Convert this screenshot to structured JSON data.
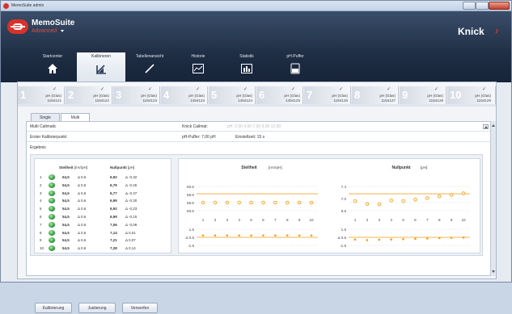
{
  "window": {
    "title": "MemoSuite admin"
  },
  "header": {
    "app_name": "MemoSuite",
    "edition": "Advanced",
    "brand": "Knick"
  },
  "tabs": [
    {
      "label": "Startcenter",
      "icon": "home-icon"
    },
    {
      "label": "Kalibrieren",
      "icon": "calibrate-icon"
    },
    {
      "label": "Tabellenansicht",
      "icon": "pen-icon"
    },
    {
      "label": "Historie",
      "icon": "history-chart-icon"
    },
    {
      "label": "Statistik",
      "icon": "statistics-icon"
    },
    {
      "label": "pH-Puffer",
      "icon": "buffer-beaker-icon"
    }
  ],
  "steps": [
    {
      "num": "1",
      "type": "pH (Glas)",
      "sn": "1154121"
    },
    {
      "num": "2",
      "type": "pH (Glas)",
      "sn": "1154122"
    },
    {
      "num": "3",
      "type": "pH (Glas)",
      "sn": "1154123"
    },
    {
      "num": "4",
      "type": "pH (Glas)",
      "sn": "1454123"
    },
    {
      "num": "5",
      "type": "pH (Glas)",
      "sn": "1454124"
    },
    {
      "num": "6",
      "type": "pH (Glas)",
      "sn": "1454125"
    },
    {
      "num": "7",
      "type": "pH (Glas)",
      "sn": "1154126"
    },
    {
      "num": "8",
      "type": "pH (Glas)",
      "sn": "1154127"
    },
    {
      "num": "9",
      "type": "pH (Glas)",
      "sn": "1154128"
    },
    {
      "num": "10",
      "type": "pH (Glas)",
      "sn": "1154129"
    }
  ],
  "subtabs": {
    "single": "Single",
    "multi": "Multi"
  },
  "multi": {
    "row1_label": "Multi Calimatic",
    "knick_label": "Knick Calimat:",
    "knick_values": "pH: 2.00  4.00  7.00  9.00  12.00",
    "row2_label": "Erster Kalibrierpunkt",
    "puffer": "pH-Puffer: 7,00 pH",
    "einstellzeit": "Einstellzeit: 15 s",
    "results_label": "Ergebnis"
  },
  "table": {
    "steilheit_header": "Steilheit",
    "steilheit_unit": "[mV/pH]",
    "nullpunkt_header": "Nullpunkt",
    "nullpunkt_unit": "[pH]",
    "rows": [
      {
        "n": "1",
        "s": "54,5",
        "sd": "Δ 0,6",
        "z": "6,92",
        "zd": "Δ -0,32"
      },
      {
        "n": "2",
        "s": "54,5",
        "sd": "Δ 0,6",
        "z": "6,79",
        "zd": "Δ -0,45"
      },
      {
        "n": "3",
        "s": "54,5",
        "sd": "Δ 0,6",
        "z": "6,77",
        "zd": "Δ -0,37"
      },
      {
        "n": "4",
        "s": "54,5",
        "sd": "Δ 0,6",
        "z": "6,95",
        "zd": "Δ -0,30"
      },
      {
        "n": "5",
        "s": "54,5",
        "sd": "Δ 0,6",
        "z": "6,92",
        "zd": "Δ -0,23"
      },
      {
        "n": "6",
        "s": "54,5",
        "sd": "Δ 0,6",
        "z": "6,99",
        "zd": "Δ -0,15"
      },
      {
        "n": "7",
        "s": "54,5",
        "sd": "Δ 0,6",
        "z": "7,06",
        "zd": "Δ -0,08"
      },
      {
        "n": "8",
        "s": "54,5",
        "sd": "Δ 0,6",
        "z": "7,14",
        "zd": "Δ 0,01"
      },
      {
        "n": "9",
        "s": "54,5",
        "sd": "Δ 0,6",
        "z": "7,21",
        "zd": "Δ 0,07"
      },
      {
        "n": "10",
        "s": "54,5",
        "sd": "Δ 0,6",
        "z": "7,28",
        "zd": "Δ 0,14"
      }
    ]
  },
  "chart_data": [
    {
      "type": "scatter",
      "title": "Steilheit",
      "unit": "[mV/pH]",
      "x": [
        1,
        2,
        3,
        4,
        5,
        6,
        7,
        8,
        9,
        10
      ],
      "x_ticks": [
        "1",
        "2",
        "3",
        "4",
        "5",
        "6",
        "7",
        "8",
        "9",
        "10"
      ],
      "y_ticks_top": [
        "60.6",
        "58.6",
        "56.6",
        "50.6"
      ],
      "y_ticks_bottom": [
        "1.6",
        "Δ 0.6",
        "-1.6"
      ],
      "values": [
        54.5,
        54.5,
        54.5,
        54.5,
        54.5,
        54.5,
        54.5,
        54.5,
        54.5,
        54.5
      ],
      "deltas": [
        0.6,
        0.6,
        0.6,
        0.6,
        0.6,
        0.6,
        0.6,
        0.6,
        0.6,
        0.6
      ],
      "color": "#f5a01a"
    },
    {
      "type": "scatter",
      "title": "Nullpunkt",
      "unit": "[pH]",
      "x": [
        1,
        2,
        3,
        4,
        5,
        6,
        7,
        8,
        9,
        10
      ],
      "x_ticks": [
        "1",
        "2",
        "3",
        "4",
        "5",
        "6",
        "7",
        "8",
        "9",
        "10"
      ],
      "y_ticks_top": [
        "7.4",
        "7.0",
        "6.6"
      ],
      "y_ticks_bottom": [
        "1.6",
        "Δ 0.6",
        "-1.6"
      ],
      "values": [
        6.92,
        6.79,
        6.77,
        6.95,
        6.92,
        6.99,
        7.06,
        7.14,
        7.21,
        7.28
      ],
      "deltas": [
        -0.32,
        -0.45,
        -0.37,
        -0.3,
        -0.23,
        -0.15,
        -0.08,
        0.01,
        0.07,
        0.14
      ],
      "color": "#f5a01a"
    }
  ],
  "footer": {
    "kalibrierung": "Kalibrierung",
    "justierung": "Justierung",
    "verwerfen": "Verwerfen"
  }
}
